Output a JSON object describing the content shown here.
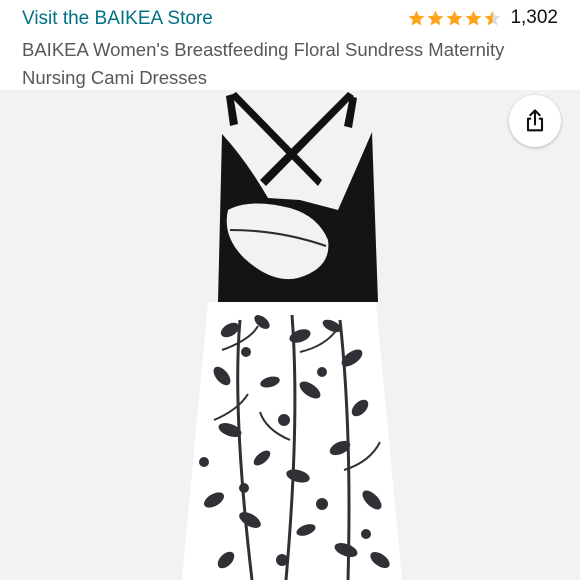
{
  "store": {
    "link_text": "Visit the BAIKEA Store"
  },
  "rating": {
    "stars": 4.5,
    "count": "1,302"
  },
  "product": {
    "title": "BAIKEA Women's Breastfeeding Floral Sundress Maternity Nursing Cami Dresses"
  },
  "colors": {
    "link": "#007185",
    "star": "#ffa41c",
    "title": "#565959",
    "image_bg": "#f2f2f2"
  },
  "icons": {
    "share": "share-icon"
  }
}
